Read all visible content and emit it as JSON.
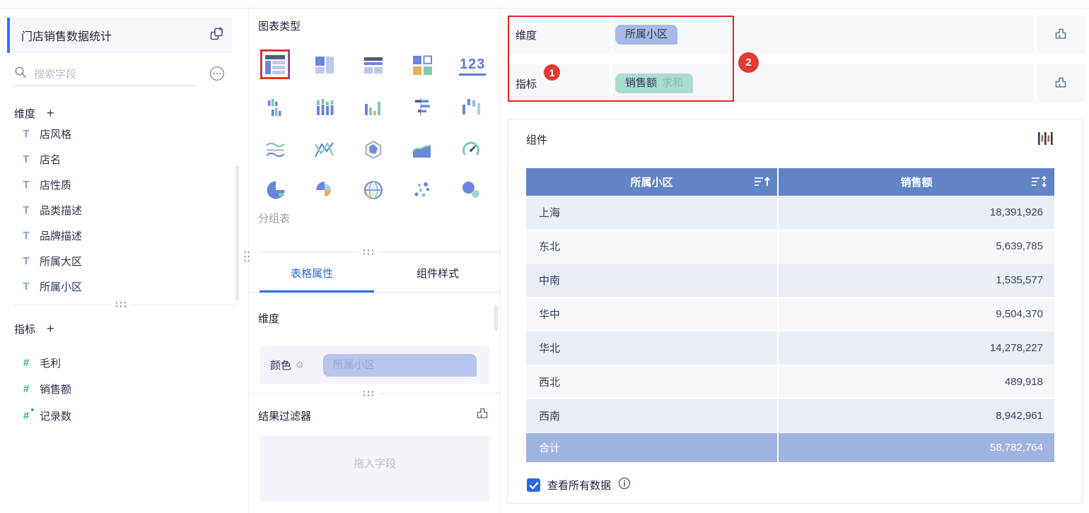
{
  "colors": {
    "accent_blue": "#3370ff",
    "tab_active_blue": "#2e6ae0",
    "table_header_blue": "#6184c7",
    "table_total_blue": "#9fb3e1",
    "row_odd": "#e9eef7",
    "row_even": "#f6f8fc",
    "dimension_pill_blue": "#a9b9e7",
    "metric_pill_teal": "#a7ddd1",
    "annotation_red": "#e12525"
  },
  "icons": {
    "text_glyph": "T",
    "hash_glyph": "#",
    "gear_glyph": "⚙"
  },
  "sidebar": {
    "title": "门店销售数据统计",
    "search_placeholder": "搜索字段",
    "dimension_header": "维度",
    "metric_header": "指标",
    "add_symbol": "+",
    "dimension_fields": [
      "店风格",
      "店名",
      "店性质",
      "品类描述",
      "品牌描述",
      "所属大区",
      "所属小区"
    ],
    "metric_fields": [
      "毛利",
      "销售额",
      "记录数"
    ]
  },
  "chart_panel": {
    "title": "图表类型",
    "kpi_icon_label": "123",
    "selected_chart_name": "分组表",
    "tabs": [
      {
        "label": "表格属性"
      },
      {
        "label": "组件样式"
      }
    ],
    "dimension_section_header": "维度",
    "color_label": "颜色",
    "color_field_pill": "所属小区",
    "result_filter_header": "结果过滤器",
    "drop_zone_placeholder": "拖入字段"
  },
  "binding_panel": {
    "dimension_label": "维度",
    "dimension_pill": "所属小区",
    "metric_label": "指标",
    "metric_pill_field": "销售额",
    "metric_pill_aggregation": "求和",
    "step1_badge": "1",
    "step2_badge": "2"
  },
  "component_panel": {
    "title": "组件",
    "view_all_data_label": "查看所有数据",
    "table": {
      "columns": [
        "所属小区",
        "销售额"
      ],
      "rows": [
        [
          "上海",
          "18,391,926"
        ],
        [
          "东北",
          "5,639,785"
        ],
        [
          "中南",
          "1,535,577"
        ],
        [
          "华中",
          "9,504,370"
        ],
        [
          "华北",
          "14,278,227"
        ],
        [
          "西北",
          "489,918"
        ],
        [
          "西南",
          "8,942,961"
        ]
      ],
      "total_row": [
        "合计",
        "58,782,764"
      ]
    }
  },
  "chart_data": {
    "type": "table",
    "columns": [
      "所属小区",
      "销售额"
    ],
    "rows": [
      [
        "上海",
        18391926
      ],
      [
        "东北",
        5639785
      ],
      [
        "中南",
        1535577
      ],
      [
        "华中",
        9504370
      ],
      [
        "华北",
        14278227
      ],
      [
        "西北",
        489918
      ],
      [
        "西南",
        8942961
      ]
    ],
    "total": [
      "合计",
      58782764
    ]
  }
}
